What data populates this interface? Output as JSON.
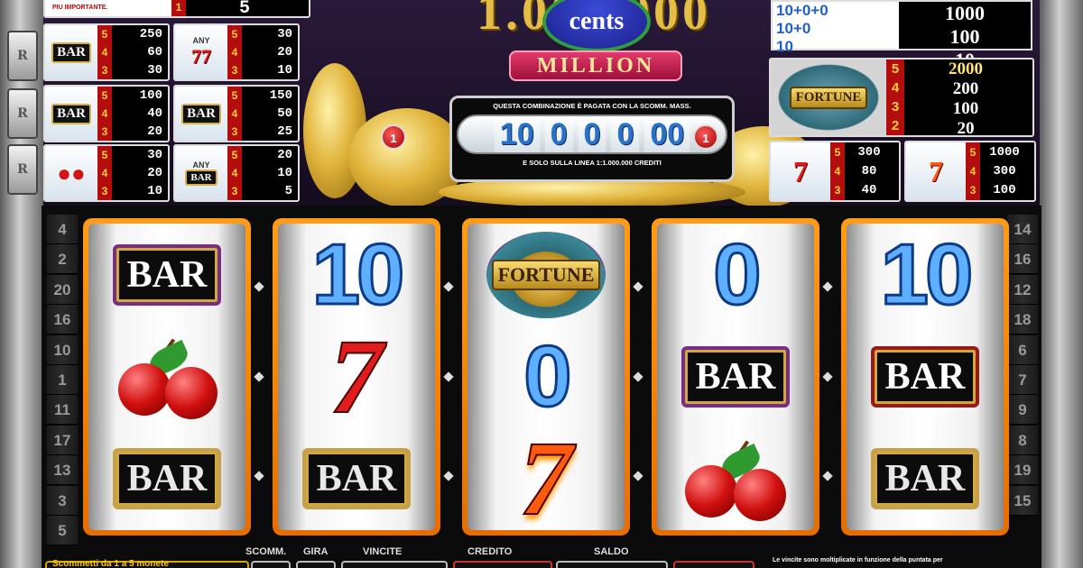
{
  "top_left_cell": {
    "note": "PIU IMPORTANTE.",
    "count": "1",
    "value": "5"
  },
  "paytable_left": [
    {
      "symbol": "bar",
      "label": "BAR",
      "rows": [
        {
          "n": "5",
          "v": "250"
        },
        {
          "n": "4",
          "v": "60"
        },
        {
          "n": "3",
          "v": "30"
        }
      ]
    },
    {
      "symbol": "any7",
      "label": "ANY",
      "rows": [
        {
          "n": "5",
          "v": "30"
        },
        {
          "n": "4",
          "v": "20"
        },
        {
          "n": "3",
          "v": "10"
        }
      ]
    },
    {
      "symbol": "bar2",
      "label": "BAR",
      "rows": [
        {
          "n": "5",
          "v": "100"
        },
        {
          "n": "4",
          "v": "40"
        },
        {
          "n": "3",
          "v": "20"
        }
      ]
    },
    {
      "symbol": "bar3",
      "label": "BAR",
      "rows": [
        {
          "n": "5",
          "v": "150"
        },
        {
          "n": "4",
          "v": "50"
        },
        {
          "n": "3",
          "v": "25"
        }
      ]
    },
    {
      "symbol": "cherry",
      "label": "",
      "rows": [
        {
          "n": "5",
          "v": "30"
        },
        {
          "n": "4",
          "v": "20"
        },
        {
          "n": "3",
          "v": "10"
        }
      ]
    },
    {
      "symbol": "anybar",
      "label": "ANY",
      "sub": "BAR",
      "rows": [
        {
          "n": "5",
          "v": "20"
        },
        {
          "n": "4",
          "v": "10"
        },
        {
          "n": "3",
          "v": "5"
        }
      ]
    }
  ],
  "logo": {
    "digits": "1.000.000",
    "cents": "cents",
    "million": "MILLION"
  },
  "jackpot": {
    "note_top": "QUESTA COMBINAZIONE È PAGATA CON LA SCOMM. MASS.",
    "digits": [
      "10",
      "0",
      "0",
      "0",
      "00"
    ],
    "note_bottom": "E SOLO SULLA LINEA 1:1.000.000 CREDITI",
    "line_left": "1",
    "line_right": "1"
  },
  "paytable_right_top": {
    "left": [
      "10+0+0",
      "10+0",
      "10"
    ],
    "right": [
      "1000",
      "100",
      "10"
    ]
  },
  "paytable_fortune": {
    "label": "FORTUNE",
    "rows": [
      {
        "n": "5",
        "v": "2000"
      },
      {
        "n": "4",
        "v": "200"
      },
      {
        "n": "3",
        "v": "100"
      },
      {
        "n": "2",
        "v": "20"
      }
    ]
  },
  "paytable_sevens": [
    {
      "symbol": "seven",
      "rows": [
        {
          "n": "5",
          "v": "300"
        },
        {
          "n": "4",
          "v": "80"
        },
        {
          "n": "3",
          "v": "40"
        }
      ]
    },
    {
      "symbol": "seven-fire",
      "rows": [
        {
          "n": "5",
          "v": "1000"
        },
        {
          "n": "4",
          "v": "300"
        },
        {
          "n": "3",
          "v": "100"
        }
      ]
    }
  ],
  "left_lines": [
    "4",
    "2",
    "20",
    "16",
    "10",
    "1",
    "11",
    "17",
    "13",
    "3",
    "5"
  ],
  "right_lines": [
    "14",
    "16",
    "12",
    "18",
    "6",
    "7",
    "9",
    "8",
    "19",
    "15"
  ],
  "side_stubs_left": [
    "R",
    "R",
    "R"
  ],
  "reels": [
    {
      "symbols": [
        "bar",
        "cherry",
        "bar"
      ]
    },
    {
      "symbols": [
        "ten",
        "seven",
        "bar-gold"
      ]
    },
    {
      "symbols": [
        "fortune",
        "zero",
        "seven-fire"
      ]
    },
    {
      "symbols": [
        "zero",
        "bar",
        "cherry"
      ]
    },
    {
      "symbols": [
        "ten",
        "bar-red",
        "bar-gold"
      ]
    }
  ],
  "symbol_text": {
    "bar": "BAR",
    "ten": "10",
    "zero": "0",
    "seven": "7",
    "fortune": "FORTUNE"
  },
  "bottom": {
    "bet_info": "Scommetti da 1 a 5 monete",
    "labels": [
      "SCOMM.",
      "GIRA",
      "VINCITE",
      "CREDITO",
      "SALDO"
    ],
    "note": "Le vincite sono moltiplicate in funzione della puntata per"
  },
  "colors": {
    "reel_frame": "#ff9c17",
    "count_bg": "#b40d0d",
    "count_text": "#ffd23a",
    "ten_blue": "#5eb0ff",
    "seven_red": "#e01c1c"
  }
}
